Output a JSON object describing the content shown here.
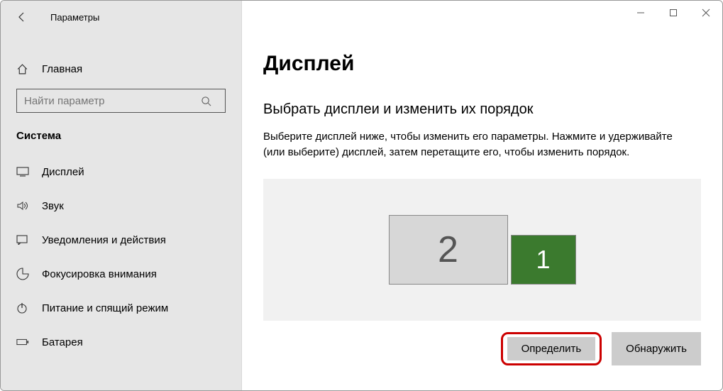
{
  "window": {
    "title": "Параметры"
  },
  "sidebar": {
    "home": "Главная",
    "search_placeholder": "Найти параметр",
    "category": "Система",
    "items": [
      {
        "label": "Дисплей"
      },
      {
        "label": "Звук"
      },
      {
        "label": "Уведомления и действия"
      },
      {
        "label": "Фокусировка внимания"
      },
      {
        "label": "Питание и спящий режим"
      },
      {
        "label": "Батарея"
      }
    ]
  },
  "main": {
    "title": "Дисплей",
    "subtitle": "Выбрать дисплеи и изменить их порядок",
    "description": "Выберите дисплей ниже, чтобы изменить его параметры. Нажмите и удерживайте (или выберите) дисплей, затем перетащите его, чтобы изменить порядок.",
    "display_labels": {
      "primary": "1",
      "secondary": "2"
    },
    "buttons": {
      "identify": "Определить",
      "detect": "Обнаружить"
    }
  }
}
